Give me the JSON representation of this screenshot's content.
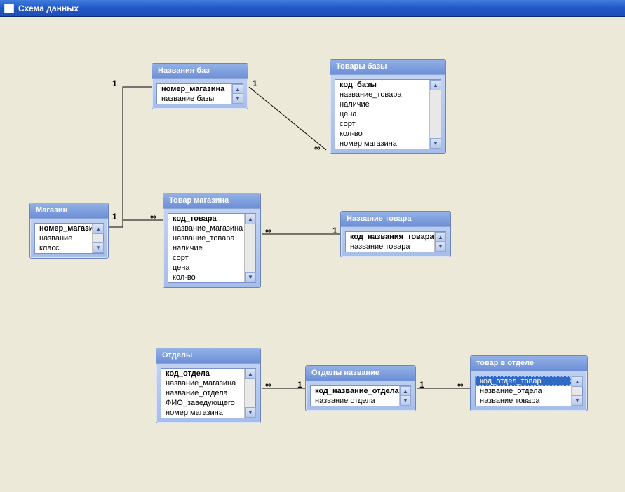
{
  "window": {
    "title": "Схема данных"
  },
  "tables": {
    "magazin": {
      "title": "Магазин",
      "fields": [
        "номер_магазина",
        "название",
        "класс"
      ],
      "bold": [
        0
      ]
    },
    "nazvaniya_baz": {
      "title": "Названия баз",
      "fields": [
        "номер_магазина",
        "название базы"
      ],
      "bold": [
        0
      ]
    },
    "tovary_bazy": {
      "title": "Товары базы",
      "fields": [
        "код_базы",
        "название_товара",
        "наличие",
        "цена",
        "сорт",
        "кол-во",
        "номер магазина"
      ],
      "bold": [
        0
      ]
    },
    "tovar_magazina": {
      "title": "Товар магазина",
      "fields": [
        "код_товара",
        "название_магазина",
        "название_товара",
        "наличие",
        "сорт",
        "цена",
        "кол-во"
      ],
      "bold": [
        0
      ]
    },
    "nazvanie_tovara": {
      "title": "Название товара",
      "fields": [
        "код_названия_товара",
        "название товара"
      ],
      "bold": [
        0
      ]
    },
    "otdely": {
      "title": "Отделы",
      "fields": [
        "код_отдела",
        "название_магазина",
        "название_отдела",
        "ФИО_заведующего",
        "номер магазина"
      ],
      "bold": [
        0
      ]
    },
    "otdely_nazvanie": {
      "title": "Отделы название",
      "fields": [
        "код_название_отдела",
        "название отдела"
      ],
      "bold": [
        0
      ]
    },
    "tovar_v_otdele": {
      "title": "товар в отделе",
      "fields": [
        "код_отдел_товар",
        "название_отдела",
        "название товара"
      ],
      "selected": [
        0
      ]
    }
  },
  "relations": {
    "r1": {
      "from": "1",
      "to": "1"
    },
    "r2": {
      "from": "1",
      "to": "∞"
    },
    "r3": {
      "from": "1",
      "to": "∞"
    },
    "r4": {
      "from": "∞",
      "to": "1"
    },
    "r5": {
      "from": "∞",
      "to": "1"
    },
    "r6": {
      "from": "1",
      "to": "∞"
    }
  }
}
